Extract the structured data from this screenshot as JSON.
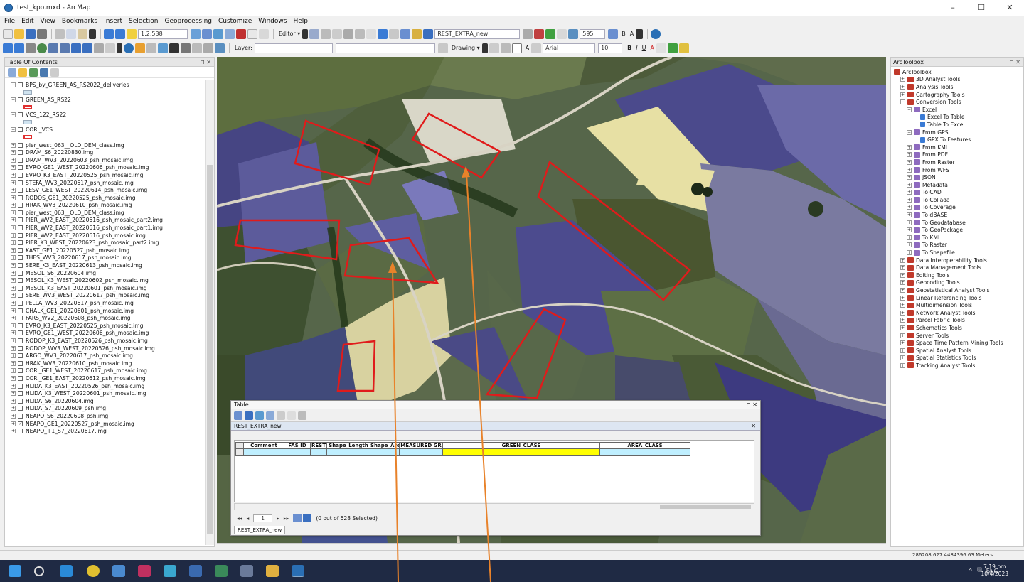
{
  "window": {
    "title": "test_kpo.mxd - ArcMap",
    "controls": [
      "–",
      "☐",
      "✕"
    ]
  },
  "menus": [
    "File",
    "Edit",
    "View",
    "Bookmarks",
    "Insert",
    "Selection",
    "Geoprocessing",
    "Customize",
    "Windows",
    "Help"
  ],
  "toolbar": {
    "scale": "1:2,538",
    "editor": "Editor ▾",
    "layer_combo": "REST_EXTRA_new",
    "zoom_combo": "595",
    "layer_label": "Layer:",
    "drawing": "Drawing ▾",
    "font_combo": "Arial",
    "font_size": "10",
    "bold": "B",
    "italic": "I",
    "underline": "U",
    "font_color": "A"
  },
  "toc": {
    "title": "Table Of Contents",
    "pin": "⊓ ✕",
    "layers": [
      {
        "name": "BPS_by_GREEN_AS_RS2022_deliveries",
        "checked": false,
        "symbol": "#cfe3f0"
      },
      {
        "name": "GREEN_AS_RS22",
        "checked": false,
        "symbol": "#e03030"
      },
      {
        "name": "VCS_122_RS22",
        "checked": false,
        "symbol": "#cfe3f0"
      },
      {
        "name": "CORI_VCS",
        "checked": false,
        "symbol": "#e03030"
      },
      {
        "name": "pier_west_063__OLD_DEM_class.img",
        "checked": false
      },
      {
        "name": "DRAM_S6_20220830.img",
        "checked": false
      },
      {
        "name": "DRAM_WV3_20220603_psh_mosaic.img",
        "checked": false
      },
      {
        "name": "EVRO_GE1_WEST_20220606_psh_mosaic.img",
        "checked": false
      },
      {
        "name": "EVRO_K3_EAST_20220525_psh_mosaic.img",
        "checked": false
      },
      {
        "name": "STEFA_WV3_20220617_psh_mosaic.img",
        "checked": false
      },
      {
        "name": "LESV_GE1_WEST_20220614_psh_mosaic.img",
        "checked": false
      },
      {
        "name": "RODOS_GE1_20220525_psh_mosaic.img",
        "checked": false
      },
      {
        "name": "HRAK_WV3_20220610_psh_mosaic.img",
        "checked": false
      },
      {
        "name": "pier_west_063__OLD_DEM_class.img",
        "checked": false
      },
      {
        "name": "PIER_WV2_EAST_20220616_psh_mosaic_part2.img",
        "checked": false
      },
      {
        "name": "PIER_WV2_EAST_20220616_psh_mosaic_part1.img",
        "checked": false
      },
      {
        "name": "PIER_WV2_EAST_20220616_psh_mosaic.img",
        "checked": false
      },
      {
        "name": "PIER_K3_WEST_20220623_psh_mosaic_part2.img",
        "checked": false
      },
      {
        "name": "KAST_GE1_20220527_psh_mosaic.img",
        "checked": false
      },
      {
        "name": "THES_WV3_20220617_psh_mosaic.img",
        "checked": false
      },
      {
        "name": "SERE_K3_EAST_20220613_psh_mosaic.img",
        "checked": false
      },
      {
        "name": "MESOL_S6_20220604.img",
        "checked": false
      },
      {
        "name": "MESOL_K3_WEST_20220602_psh_mosaic.img",
        "checked": false
      },
      {
        "name": "MESOL_K3_EAST_20220601_psh_mosaic.img",
        "checked": false
      },
      {
        "name": "SERE_WV3_WEST_20220617_psh_mosaic.img",
        "checked": false
      },
      {
        "name": "PELLA_WV3_20220617_psh_mosaic.img",
        "checked": false
      },
      {
        "name": "CHALK_GE1_20220601_psh_mosaic.img",
        "checked": false
      },
      {
        "name": "FARS_WV2_20220608_psh_mosaic.img",
        "checked": false
      },
      {
        "name": "EVRO_K3_EAST_20220525_psh_mosaic.img",
        "checked": false
      },
      {
        "name": "EVRO_GE1_WEST_20220606_psh_mosaic.img",
        "checked": false
      },
      {
        "name": "RODOP_K3_EAST_20220526_psh_mosaic.img",
        "checked": false
      },
      {
        "name": "RODOP_WV3_WEST_20220526_psh_mosaic.img",
        "checked": false
      },
      {
        "name": "ARGO_WV3_20220617_psh_mosaic.img",
        "checked": false
      },
      {
        "name": "HRAK_WV3_20220610_psh_mosaic.img",
        "checked": false
      },
      {
        "name": "CORI_GE1_WEST_20220617_psh_mosaic.img",
        "checked": false
      },
      {
        "name": "CORI_GE1_EAST_20220612_psh_mosaic.img",
        "checked": false
      },
      {
        "name": "HLIDA_K3_EAST_20220526_psh_mosaic.img",
        "checked": false
      },
      {
        "name": "HLIDA_K3_WEST_20220601_psh_mosaic.img",
        "checked": false
      },
      {
        "name": "HLIDA_S6_20220604.img",
        "checked": false
      },
      {
        "name": "HLIDA_S7_20220609_psh.img",
        "checked": false
      },
      {
        "name": "NEAPO_S6_20220608_psh.img",
        "checked": false
      },
      {
        "name": "NEAPO_GE1_20220527_psh_mosaic.img",
        "checked": true
      },
      {
        "name": "NEAPO_+1_S7_20220617.img",
        "checked": false
      }
    ]
  },
  "table_window": {
    "title": "Table",
    "controls": "⊓ ✕",
    "table_name": "REST_EXTRA_new",
    "close": "✕",
    "columns": [
      "Comment",
      "FAS ID",
      "REST",
      "Shape_Length",
      "Shape_Area",
      "MEASURED GR",
      "GREEN_CLASS",
      "AREA_CLASS"
    ],
    "nav": {
      "first": "◂◂",
      "prev": "◂",
      "value": "1",
      "next": "▸",
      "last": "▸▸",
      "selection": "(0 out of 528 Selected)"
    },
    "tab": "REST_EXTRA_new"
  },
  "arctoolbox": {
    "title": "ArcToolbox",
    "pin": "⊓ ✕",
    "items": [
      {
        "label": "ArcToolbox",
        "level": 0,
        "kind": "root"
      },
      {
        "label": "3D Analyst Tools",
        "level": 1,
        "kind": "tb",
        "exp": "+"
      },
      {
        "label": "Analysis Tools",
        "level": 1,
        "kind": "tb",
        "exp": "+"
      },
      {
        "label": "Cartography Tools",
        "level": 1,
        "kind": "tb",
        "exp": "+"
      },
      {
        "label": "Conversion Tools",
        "level": 1,
        "kind": "tb",
        "exp": "−"
      },
      {
        "label": "Excel",
        "level": 2,
        "kind": "ts",
        "exp": "−"
      },
      {
        "label": "Excel To Table",
        "level": 3,
        "kind": "tool"
      },
      {
        "label": "Table To Excel",
        "level": 3,
        "kind": "tool"
      },
      {
        "label": "From GPS",
        "level": 2,
        "kind": "ts",
        "exp": "−"
      },
      {
        "label": "GPX To Features",
        "level": 3,
        "kind": "tool"
      },
      {
        "label": "From KML",
        "level": 2,
        "kind": "ts",
        "exp": "+"
      },
      {
        "label": "From PDF",
        "level": 2,
        "kind": "ts",
        "exp": "+"
      },
      {
        "label": "From Raster",
        "level": 2,
        "kind": "ts",
        "exp": "+"
      },
      {
        "label": "From WFS",
        "level": 2,
        "kind": "ts",
        "exp": "+"
      },
      {
        "label": "JSON",
        "level": 2,
        "kind": "ts",
        "exp": "+"
      },
      {
        "label": "Metadata",
        "level": 2,
        "kind": "ts",
        "exp": "+"
      },
      {
        "label": "To CAD",
        "level": 2,
        "kind": "ts",
        "exp": "+"
      },
      {
        "label": "To Collada",
        "level": 2,
        "kind": "ts",
        "exp": "+"
      },
      {
        "label": "To Coverage",
        "level": 2,
        "kind": "ts",
        "exp": "+"
      },
      {
        "label": "To dBASE",
        "level": 2,
        "kind": "ts",
        "exp": "+"
      },
      {
        "label": "To Geodatabase",
        "level": 2,
        "kind": "ts",
        "exp": "+"
      },
      {
        "label": "To GeoPackage",
        "level": 2,
        "kind": "ts",
        "exp": "+"
      },
      {
        "label": "To KML",
        "level": 2,
        "kind": "ts",
        "exp": "+"
      },
      {
        "label": "To Raster",
        "level": 2,
        "kind": "ts",
        "exp": "+"
      },
      {
        "label": "To Shapefile",
        "level": 2,
        "kind": "ts",
        "exp": "+"
      },
      {
        "label": "Data Interoperability Tools",
        "level": 1,
        "kind": "tb",
        "exp": "+"
      },
      {
        "label": "Data Management Tools",
        "level": 1,
        "kind": "tb",
        "exp": "+"
      },
      {
        "label": "Editing Tools",
        "level": 1,
        "kind": "tb",
        "exp": "+"
      },
      {
        "label": "Geocoding Tools",
        "level": 1,
        "kind": "tb",
        "exp": "+"
      },
      {
        "label": "Geostatistical Analyst Tools",
        "level": 1,
        "kind": "tb",
        "exp": "+"
      },
      {
        "label": "Linear Referencing Tools",
        "level": 1,
        "kind": "tb",
        "exp": "+"
      },
      {
        "label": "Multidimension Tools",
        "level": 1,
        "kind": "tb",
        "exp": "+"
      },
      {
        "label": "Network Analyst Tools",
        "level": 1,
        "kind": "tb",
        "exp": "+"
      },
      {
        "label": "Parcel Fabric Tools",
        "level": 1,
        "kind": "tb",
        "exp": "+"
      },
      {
        "label": "Schematics Tools",
        "level": 1,
        "kind": "tb",
        "exp": "+"
      },
      {
        "label": "Server Tools",
        "level": 1,
        "kind": "tb",
        "exp": "+"
      },
      {
        "label": "Space Time Pattern Mining Tools",
        "level": 1,
        "kind": "tb",
        "exp": "+"
      },
      {
        "label": "Spatial Analyst Tools",
        "level": 1,
        "kind": "tb",
        "exp": "+"
      },
      {
        "label": "Spatial Statistics Tools",
        "level": 1,
        "kind": "tb",
        "exp": "+"
      },
      {
        "label": "Tracking Analyst Tools",
        "level": 1,
        "kind": "tb",
        "exp": "+"
      }
    ]
  },
  "status": {
    "coords": "286208.627 4484396.63 Meters"
  },
  "taskbar": {
    "tray": [
      "^",
      "🖫",
      "ENG"
    ],
    "time": "7:19 pm",
    "date": "10/4/2023"
  },
  "colors": {
    "polygon_outline": "#e01b1b",
    "annotation_arrow": "#e8822a",
    "selected_row": "#bfefff",
    "green_class_field": "#ffff00",
    "taskbar": "#1f2a44"
  }
}
